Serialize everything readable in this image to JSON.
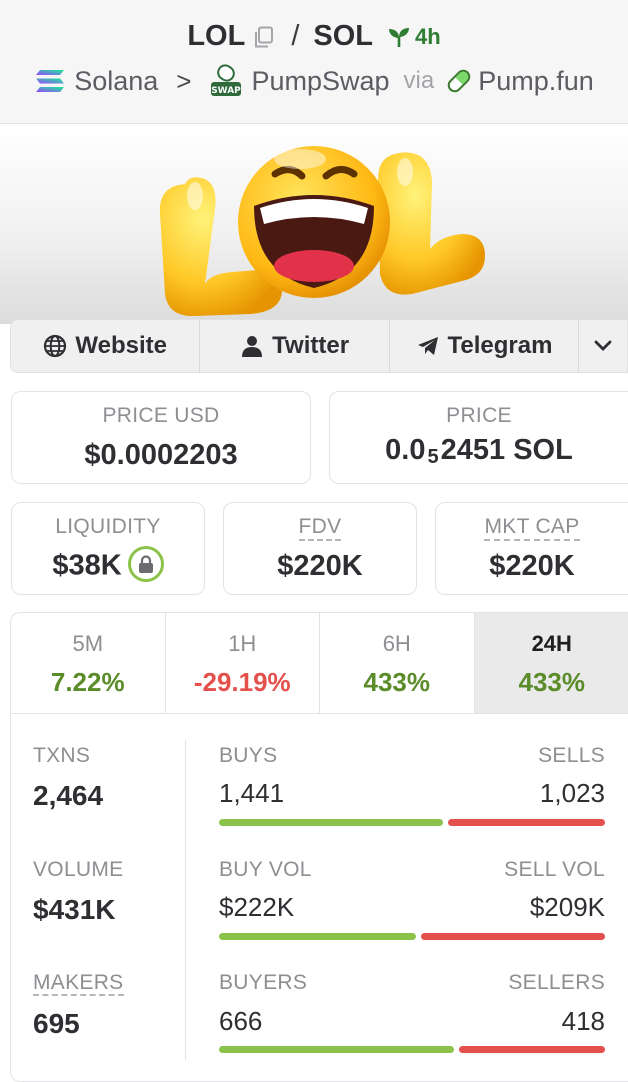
{
  "header": {
    "base_token": "LOL",
    "separator": "/",
    "quote_token": "SOL",
    "age": "4h",
    "chain": "Solana",
    "chain_chevron": ">",
    "dex": "PumpSwap",
    "dex_logo_text": "SWAP",
    "via": "via",
    "launchpad": "Pump.fun"
  },
  "banner": {
    "logo_text": "LOL"
  },
  "links": {
    "website": "Website",
    "twitter": "Twitter",
    "telegram": "Telegram"
  },
  "prices": {
    "price_usd_label": "PRICE USD",
    "price_usd": "$0.0002203",
    "price_label": "PRICE",
    "price_prefix": "0.0",
    "price_zeros": "5",
    "price_digits": "2451 SOL"
  },
  "metrics": {
    "liquidity_label": "LIQUIDITY",
    "liquidity": "$38K",
    "fdv_label": "FDV",
    "fdv": "$220K",
    "mktcap_label": "MKT CAP",
    "mktcap": "$220K"
  },
  "timeframes": [
    {
      "label": "5M",
      "change": "7.22%"
    },
    {
      "label": "1H",
      "change": "-29.19%"
    },
    {
      "label": "6H",
      "change": "433%"
    },
    {
      "label": "24H",
      "change": "433%"
    }
  ],
  "stats": {
    "txns_label": "TXNS",
    "txns": "2,464",
    "buys_label": "BUYS",
    "buys": "1,441",
    "sells_label": "SELLS",
    "sells": "1,023",
    "volume_label": "VOLUME",
    "volume": "$431K",
    "buy_vol_label": "BUY VOL",
    "buy_vol": "$222K",
    "sell_vol_label": "SELL VOL",
    "sell_vol": "$209K",
    "makers_label": "MAKERS",
    "makers": "695",
    "buyers_label": "BUYERS",
    "buyers": "666",
    "sellers_label": "SELLERS",
    "sellers": "418",
    "buy_share_txns": 0.585,
    "buy_share_volume": 0.515,
    "buy_share_makers": 0.614
  },
  "colors": {
    "positive": "#5b8c2a",
    "negative": "#e4514d",
    "buy_bar": "#8bc34a",
    "sell_bar": "#e4514d",
    "age_green": "#2e7d32"
  }
}
